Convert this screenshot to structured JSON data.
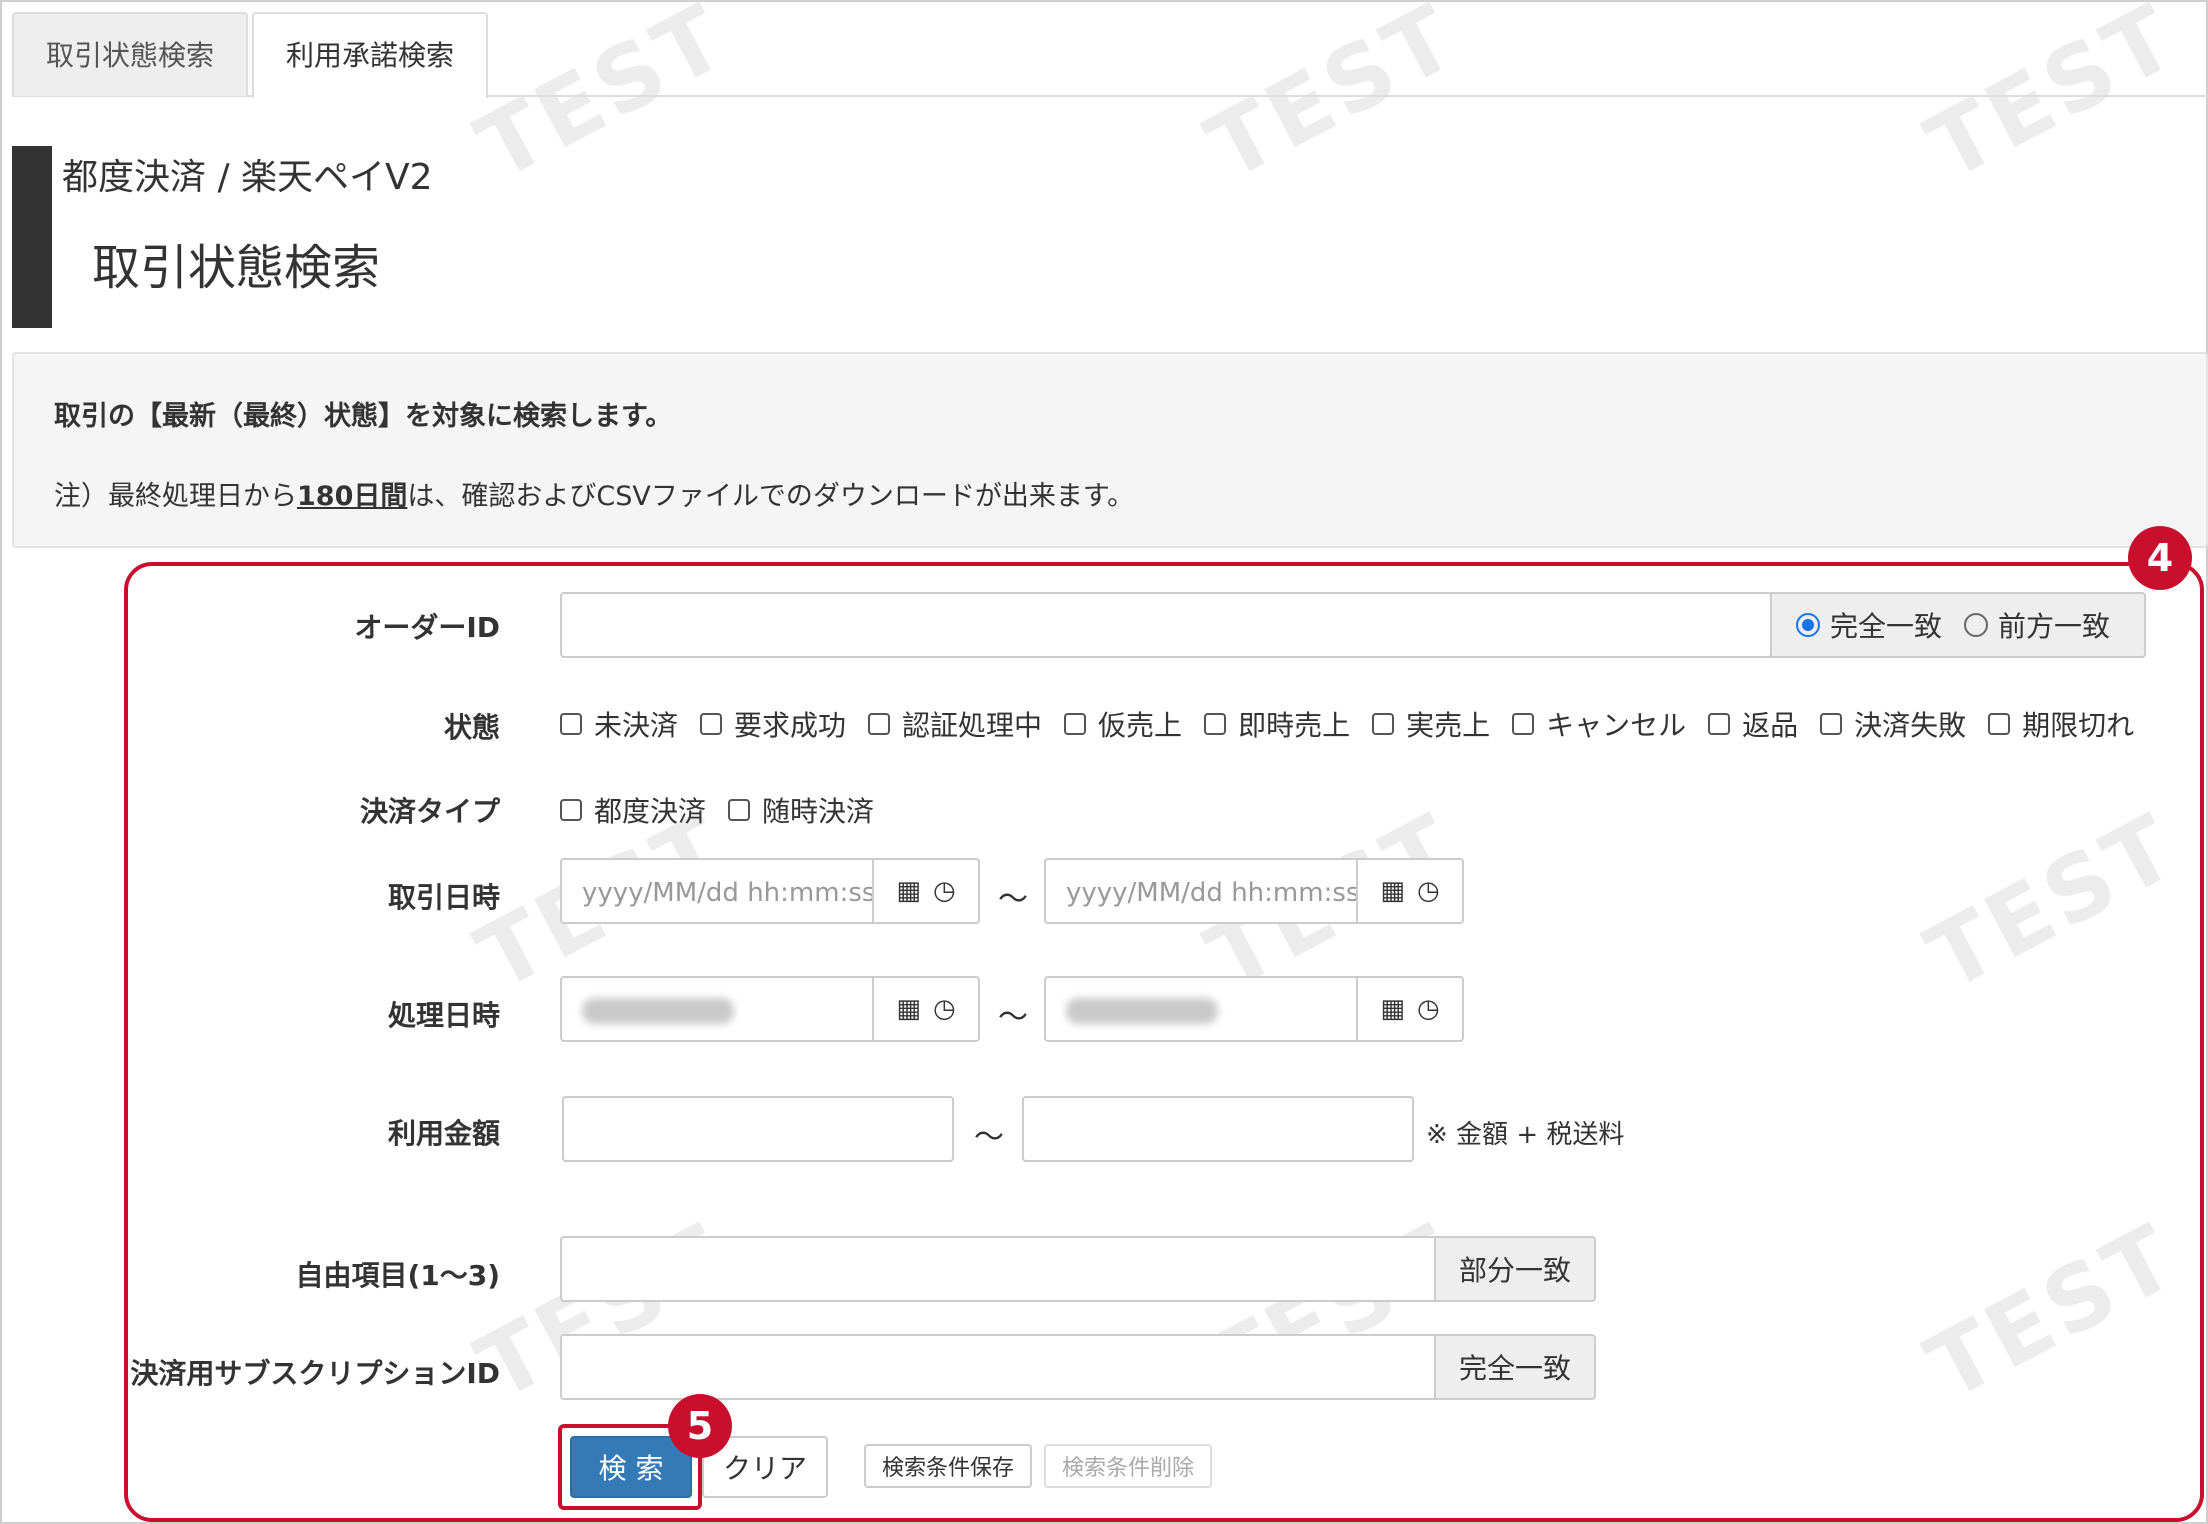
{
  "tabs": [
    {
      "label": "取引状態検索",
      "active": false
    },
    {
      "label": "利用承諾検索",
      "active": true
    }
  ],
  "breadcrumb": "都度決済 / 楽天ペイV2",
  "page_title": "取引状態検索",
  "info": {
    "line1": "取引の【最新（最終）状態】を対象に検索します。",
    "line2_prefix": "注）最終処理日から",
    "line2_bold": "180日間",
    "line2_suffix": "は、確認およびCSVファイルでのダウンロードが出来ます。"
  },
  "annotations": {
    "box": "4",
    "button": "5"
  },
  "form": {
    "order_id": {
      "label": "オーダーID",
      "match_options": [
        "完全一致",
        "前方一致"
      ],
      "match_selected": "完全一致"
    },
    "status": {
      "label": "状態",
      "options": [
        "未決済",
        "要求成功",
        "認証処理中",
        "仮売上",
        "即時売上",
        "実売上",
        "キャンセル",
        "返品",
        "決済失敗",
        "期限切れ"
      ]
    },
    "payment_type": {
      "label": "決済タイプ",
      "options": [
        "都度決済",
        "随時決済"
      ]
    },
    "transaction_datetime": {
      "label": "取引日時",
      "from_placeholder": "yyyy/MM/dd hh:mm:ss",
      "to_placeholder": "yyyy/MM/dd hh:mm:ss",
      "separator": "～"
    },
    "processing_datetime": {
      "label": "処理日時",
      "separator": "～"
    },
    "amount": {
      "label": "利用金額",
      "separator": "～",
      "note": "※ 金額 + 税送料"
    },
    "free_item": {
      "label": "自由項目(1～3)",
      "match": "部分一致"
    },
    "subscription_id": {
      "label": "決済用サブスクリプションID",
      "match": "完全一致"
    }
  },
  "buttons": {
    "search": "検 索",
    "clear": "クリア",
    "save_conditions": "検索条件保存",
    "delete_conditions": "検索条件削除"
  },
  "watermark": "TEST",
  "colors": {
    "accent_red": "#c8102e",
    "primary_blue": "#337ab7"
  }
}
